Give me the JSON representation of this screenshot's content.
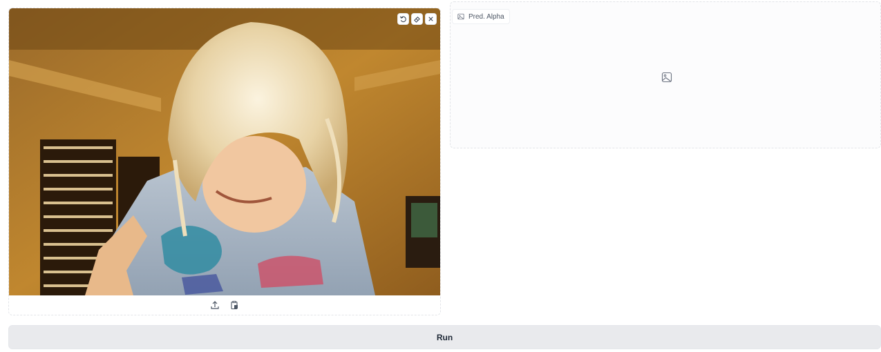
{
  "input_image": {
    "description_icons": {
      "undo": "undo-icon",
      "erase": "eraser-icon",
      "close": "close-icon",
      "upload": "upload-icon",
      "paste": "clipboard-icon"
    }
  },
  "output_image": {
    "label": "Pred. Alpha",
    "label_icon": "image-icon",
    "placeholder_icon": "image-icon"
  },
  "run_button": {
    "label": "Run"
  },
  "colors": {
    "border": "#e2e4e8",
    "run_bg": "#e9eaed",
    "text": "#1f2937"
  }
}
